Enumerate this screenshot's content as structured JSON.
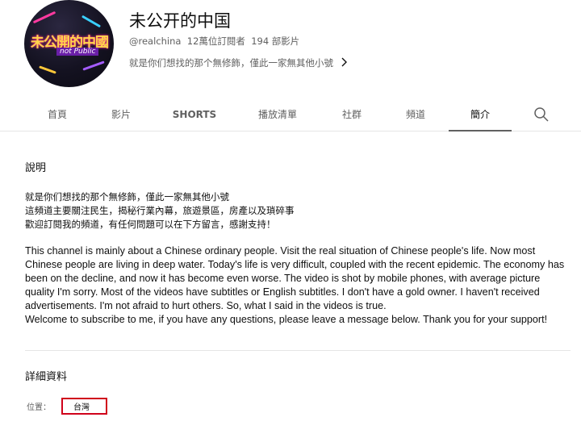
{
  "channel": {
    "avatar_text": "未公開的中國",
    "avatar_subtext": "not Public",
    "name": "未公开的中国",
    "handle": "@realchina",
    "subscribers": "12萬位訂閱者",
    "videos": "194 部影片",
    "short_description": "就是你们想找的那个無修飾，僅此一家無其他小號"
  },
  "tabs": [
    {
      "label": "首頁",
      "active": false
    },
    {
      "label": "影片",
      "active": false
    },
    {
      "label": "SHORTS",
      "active": false
    },
    {
      "label": "播放清單",
      "active": false
    },
    {
      "label": "社群",
      "active": false
    },
    {
      "label": "頻道",
      "active": false
    },
    {
      "label": "簡介",
      "active": true
    }
  ],
  "about": {
    "section_title": "說明",
    "zh_lines": [
      "就是你们想找的那个無修飾，僅此一家無其他小號",
      "這頻道主要關注民生，揭秘行業內幕，旅遊景區，房產以及瑣碎事",
      "歡迎訂閱我的頻道，有任何問題可以在下方留言，感謝支持！"
    ],
    "en_paragraph": "This channel is mainly about a Chinese ordinary people. Visit the real situation of Chinese people's life. Now most Chinese people are living in deep water. Today's life is very difficult, coupled with the recent epidemic. The economy has been on the decline, and now it has become even worse. The video is shot by mobile phones, with average picture quality I'm sorry. Most of the videos have subtitles or English subtitles. I don't have a gold owner. I haven't received advertisements. I'm not afraid to hurt others. So, what I said in the videos is true.",
    "en_welcome": "Welcome to subscribe to me, if you have any questions, please leave a message below. Thank you for your support!"
  },
  "details": {
    "section_title": "詳細資料",
    "location_label": "位置：",
    "location_value": "台灣"
  },
  "colors": {
    "highlight_box": "#d0021b",
    "secondary_text": "#606060"
  },
  "icons": {
    "search": "search-icon",
    "chevron": "chevron-right-icon"
  }
}
